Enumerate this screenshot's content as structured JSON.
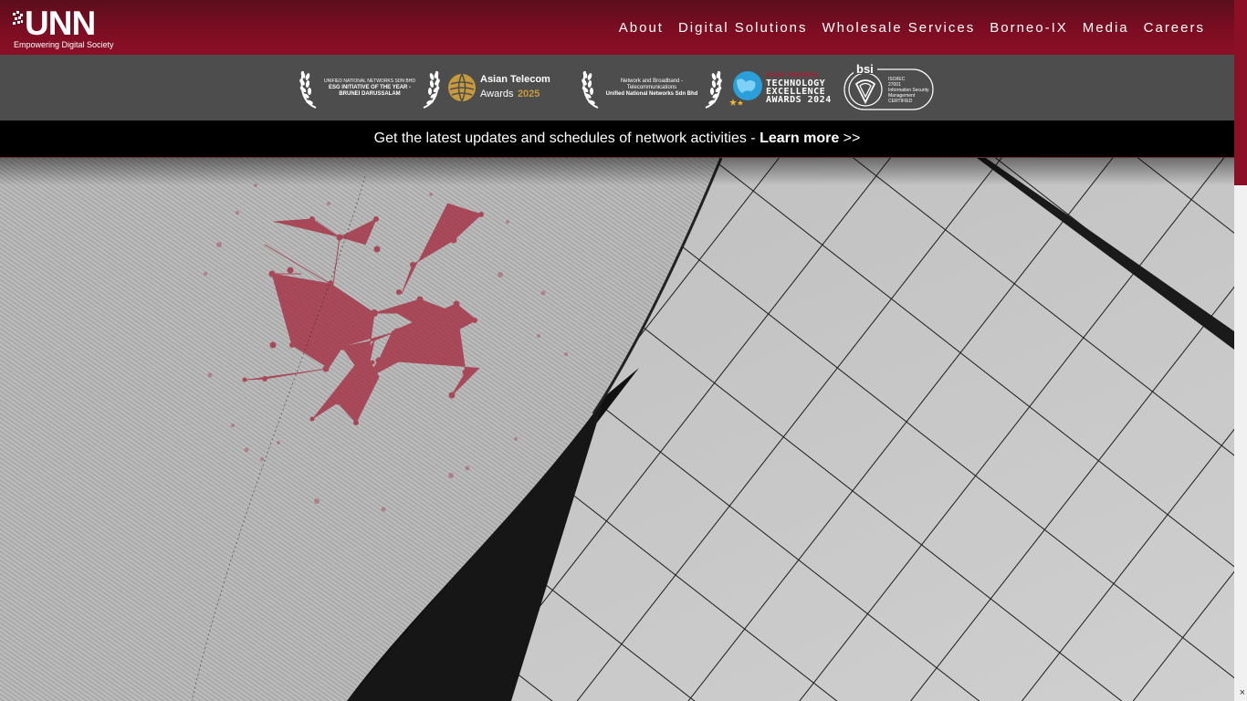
{
  "brand": {
    "logo_text": "UNN",
    "tagline": "Empowering Digital Society"
  },
  "nav": {
    "items": [
      "About",
      "Digital Solutions",
      "Wholesale Services",
      "Borneo-IX",
      "Media",
      "Careers"
    ]
  },
  "awards": {
    "esg": {
      "line1": "UNIFIED NATIONAL NETWORKS SDN BHD",
      "line2": "ESG INITIATIVE OF THE YEAR -",
      "line3": "BRUNEI DARUSSALAM"
    },
    "asian_telecom": {
      "name": "Asian Telecom",
      "awards": "Awards",
      "year": "2025"
    },
    "network": {
      "line1": "Network and Broadband -",
      "line2": "Telecommunications",
      "line3": "Unified National Networks Sdn Bhd"
    },
    "tech_excellence": {
      "top": "ASIAN BUSINESS",
      "line1": "TECHNOLOGY",
      "line2": "EXCELLENCE",
      "line3": "AWARDS 2024"
    },
    "bsi": {
      "name": "bsi",
      "line1": "ISO/IEC",
      "line2": "27001",
      "line3": "Information Security",
      "line4": "Management",
      "line5": "CERTIFIED"
    }
  },
  "notice": {
    "text": "Get the latest updates and schedules of network activities - ",
    "link": "Learn more",
    "suffix": " >>"
  },
  "colors": {
    "brand": "#8b0f27",
    "awards_bg": "#4d4d4d",
    "notice_bg": "#000000",
    "gold": "#c79a3e"
  },
  "icons": {
    "close": "×"
  }
}
